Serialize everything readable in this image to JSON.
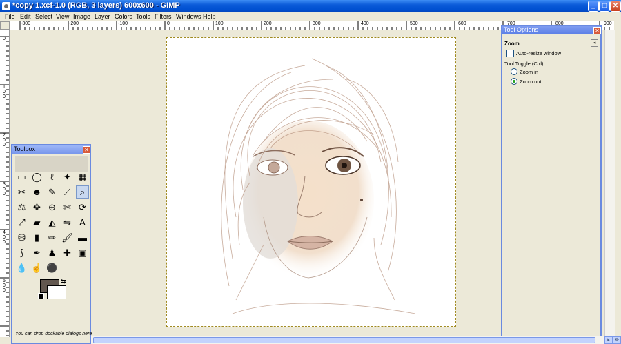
{
  "window": {
    "title": "*copy 1.xcf-1.0 (RGB, 3 layers) 600x600 - GIMP",
    "minimize": "_",
    "maximize": "□",
    "close": "✕"
  },
  "menu": [
    "File",
    "Edit",
    "Select",
    "View",
    "Image",
    "Layer",
    "Colors",
    "Tools",
    "Filters",
    "Windows",
    "Help"
  ],
  "ruler_top": [
    "-300",
    "-200",
    "-100",
    "0",
    "100",
    "200",
    "300",
    "400",
    "500",
    "600",
    "700",
    "800",
    "900"
  ],
  "ruler_left": [
    "0",
    "1 0 0",
    "2 0 0",
    "3 0 0",
    "4 0 0",
    "5 0 0"
  ],
  "toolbox": {
    "title": "Toolbox",
    "tools": [
      {
        "icon": "rect-select-icon",
        "glyph": "▭"
      },
      {
        "icon": "ellipse-select-icon",
        "glyph": "◯"
      },
      {
        "icon": "lasso-icon",
        "glyph": "ℓ"
      },
      {
        "icon": "magic-wand-icon",
        "glyph": "✦"
      },
      {
        "icon": "select-by-color-icon",
        "glyph": "▦"
      },
      {
        "icon": "scissors-icon",
        "glyph": "✂"
      },
      {
        "icon": "foreground-select-icon",
        "glyph": "☻"
      },
      {
        "icon": "paths-icon",
        "glyph": "✎"
      },
      {
        "icon": "color-picker-icon",
        "glyph": "⟋"
      },
      {
        "icon": "zoom-icon",
        "glyph": "⌕"
      },
      {
        "icon": "measure-icon",
        "glyph": "⚖"
      },
      {
        "icon": "move-icon",
        "glyph": "✥"
      },
      {
        "icon": "align-icon",
        "glyph": "⊕"
      },
      {
        "icon": "crop-icon",
        "glyph": "✄"
      },
      {
        "icon": "rotate-icon",
        "glyph": "⟳"
      },
      {
        "icon": "scale-icon",
        "glyph": "⤢"
      },
      {
        "icon": "shear-icon",
        "glyph": "▰"
      },
      {
        "icon": "perspective-icon",
        "glyph": "◭"
      },
      {
        "icon": "flip-icon",
        "glyph": "⇋"
      },
      {
        "icon": "text-icon",
        "glyph": "A"
      },
      {
        "icon": "bucket-fill-icon",
        "glyph": "⛁"
      },
      {
        "icon": "blend-icon",
        "glyph": "▮"
      },
      {
        "icon": "pencil-icon",
        "glyph": "✏"
      },
      {
        "icon": "paintbrush-icon",
        "glyph": "🖌"
      },
      {
        "icon": "eraser-icon",
        "glyph": "▬"
      },
      {
        "icon": "airbrush-icon",
        "glyph": "⟆"
      },
      {
        "icon": "ink-icon",
        "glyph": "✒"
      },
      {
        "icon": "clone-icon",
        "glyph": "♟"
      },
      {
        "icon": "heal-icon",
        "glyph": "✚"
      },
      {
        "icon": "perspective-clone-icon",
        "glyph": "▣"
      },
      {
        "icon": "blur-icon",
        "glyph": "💧"
      },
      {
        "icon": "smudge-icon",
        "glyph": "☝"
      },
      {
        "icon": "dodge-burn-icon",
        "glyph": "⚫"
      }
    ],
    "drop_hint": "You can drop dockable dialogs here"
  },
  "tool_options": {
    "title": "Tool Options",
    "tool_name": "Zoom",
    "auto_resize": "Auto-resize window",
    "toggle_label": "Tool Toggle  (Ctrl)",
    "zoom_in": "Zoom in",
    "zoom_out": "Zoom out",
    "selected": "zoom-out"
  },
  "colors": {
    "foreground": "#62574f",
    "background": "#ffffff",
    "titlebar": "#0a5ad8"
  }
}
